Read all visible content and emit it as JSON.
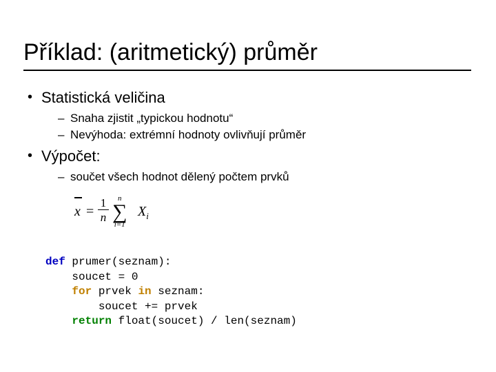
{
  "title": "Příklad: (aritmetický) průměr",
  "bullets": {
    "b1": "Statistická veličina",
    "b1_1": "Snaha zjistit „typickou hodnotu“",
    "b1_2": "Nevýhoda: extrémní hodnoty ovlivňují průměr",
    "b2": "Výpočet:",
    "b2_1": "součet všech hodnot dělený počtem prvků"
  },
  "formula": {
    "lhs_bar": "—",
    "lhs_var": "x",
    "eq": "=",
    "frac_num": "1",
    "frac_den": "n",
    "sum_top": "n",
    "sigma": "∑",
    "sum_bot": "i=1",
    "rhs": "X",
    "rhs_sub": "i"
  },
  "code": {
    "kw_def": "def",
    "l1_rest": " prumer(seznam):",
    "l2": "    soucet = 0",
    "kw_for": "for",
    "l3_mid": " prvek ",
    "kw_in": "in",
    "l3_rest": " seznam:",
    "l4": "        soucet += prvek",
    "kw_return": "return",
    "l5_rest": " float(soucet) / len(seznam)"
  }
}
